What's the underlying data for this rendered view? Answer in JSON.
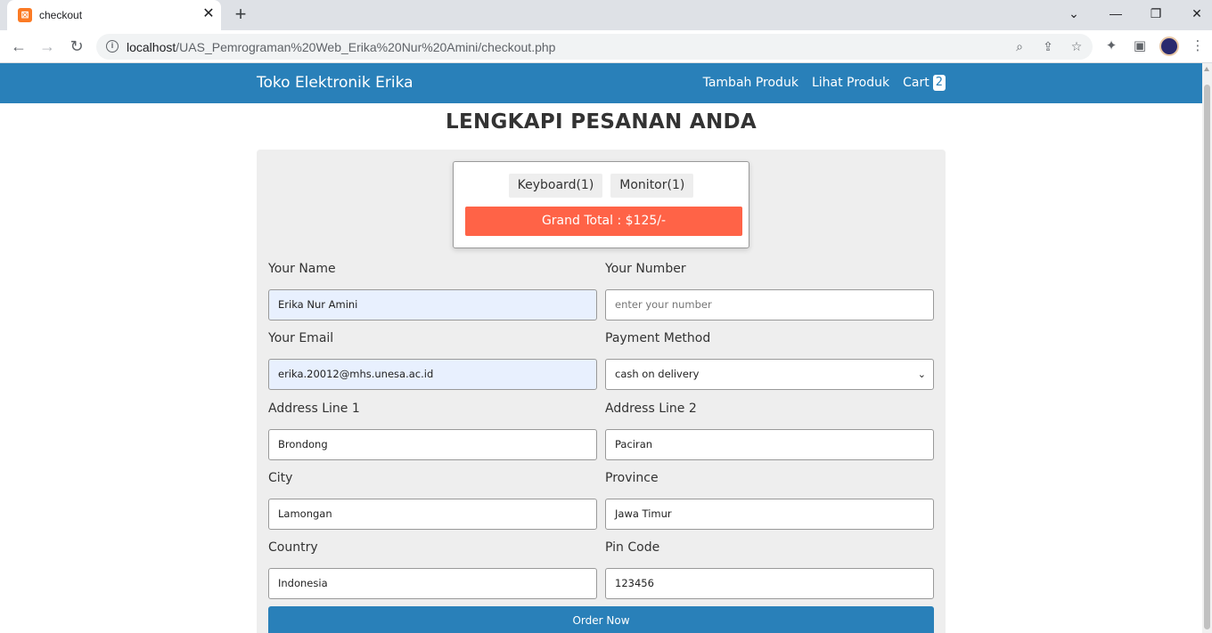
{
  "browser": {
    "tab_title": "checkout",
    "tab_favicon_glyph": "⊠",
    "url_host": "localhost",
    "url_path": "/UAS_Pemrograman%20Web_Erika%20Nur%20Amini/checkout.php"
  },
  "header": {
    "brand": "Toko Elektronik Erika",
    "nav": [
      "Tambah Produk",
      "Lihat Produk"
    ],
    "cart_label": "Cart",
    "cart_count": "2"
  },
  "page": {
    "heading": "LENGKAPI PESANAN ANDA"
  },
  "summary": {
    "items": [
      "Keyboard(1)",
      "Monitor(1)"
    ],
    "grand_total": "Grand Total : $125/-"
  },
  "form": {
    "name_label": "Your Name",
    "name_value": "Erika Nur Amini",
    "number_label": "Your Number",
    "number_placeholder": "enter your number",
    "email_label": "Your Email",
    "email_value": "erika.20012@mhs.unesa.ac.id",
    "payment_label": "Payment Method",
    "payment_value": "cash on delivery",
    "address1_label": "Address Line 1",
    "address1_value": "Brondong",
    "address2_label": "Address Line 2",
    "address2_value": "Paciran",
    "city_label": "City",
    "city_value": "Lamongan",
    "province_label": "Province",
    "province_value": "Jawa Timur",
    "country_label": "Country",
    "country_value": "Indonesia",
    "pincode_label": "Pin Code",
    "pincode_value": "123456",
    "submit_label": "Order Now"
  },
  "colors": {
    "header": "#2980b9",
    "grand_total": "#ff6347",
    "autofill": "#e8f0fe",
    "card": "#eeeeee"
  }
}
